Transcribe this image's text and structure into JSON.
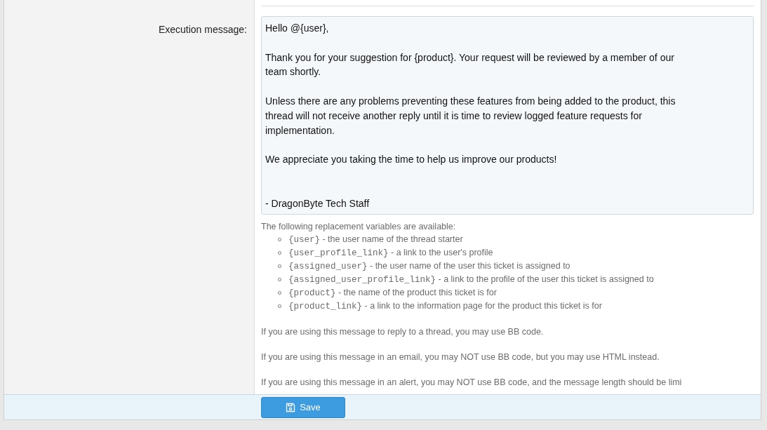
{
  "field": {
    "label": "Execution message:",
    "value": "Hello @{user},\n\nThank you for your suggestion for {product}. Your request will be reviewed by a member of our\nteam shortly.\n\nUnless there are any problems preventing these features from being added to the product, this\nthread will not receive another reply until it is time to review logged feature requests for\nimplementation.\n\nWe appreciate you taking the time to help us improve our products!\n\n\n- DragonByte Tech Staff"
  },
  "hint": {
    "intro": "The following replacement variables are available:",
    "variables": [
      {
        "code": "{user}",
        "text": " - the user name of the thread starter"
      },
      {
        "code": "{user_profile_link}",
        "text": " - a link to the user's profile"
      },
      {
        "code": "{assigned_user}",
        "text": " - the user name of the user this ticket is assigned to"
      },
      {
        "code": "{assigned_user_profile_link}",
        "text": " - a link to the profile of the user this ticket is assigned to"
      },
      {
        "code": "{product}",
        "text": " - the name of the product this ticket is for"
      },
      {
        "code": "{product_link}",
        "text": " - a link to the information page for the product this ticket is for"
      }
    ],
    "notes": [
      "If you are using this message to reply to a thread, you may use BB code.",
      "If you are using this message in an email, you may NOT use BB code, but you may use HTML instead.",
      "If you are using this message in an alert, you may NOT use BB code, and the message length should be limi"
    ]
  },
  "save_button": {
    "label": "Save"
  }
}
